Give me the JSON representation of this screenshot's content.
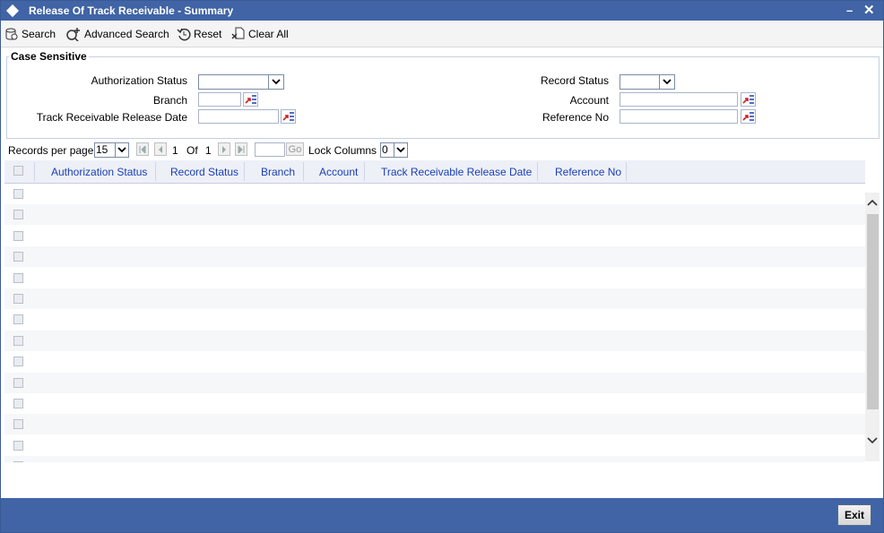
{
  "window": {
    "title": "Release Of Track Receivable - Summary",
    "minimize_label": "–",
    "close_label": "✕"
  },
  "toolbar": {
    "search": "Search",
    "advanced_search": "Advanced Search",
    "reset": "Reset",
    "clear_all": "Clear All"
  },
  "criteria": {
    "legend": "Case Sensitive",
    "authorization_status": {
      "label": "Authorization Status",
      "value": ""
    },
    "branch": {
      "label": "Branch",
      "value": ""
    },
    "track_receivable_release_date": {
      "label": "Track Receivable Release Date",
      "value": ""
    },
    "record_status": {
      "label": "Record Status",
      "value": ""
    },
    "account": {
      "label": "Account",
      "value": ""
    },
    "reference_no": {
      "label": "Reference No",
      "value": ""
    }
  },
  "pager": {
    "records_per_page_label": "Records per page",
    "records_per_page": "15",
    "current_page": "1",
    "of_label": "Of",
    "total_pages": "1",
    "go_label": "Go",
    "lock_columns_label": "Lock Columns",
    "lock_columns": "0"
  },
  "grid": {
    "columns": [
      "Authorization Status",
      "Record Status",
      "Branch",
      "Account",
      "Track Receivable Release Date",
      "Reference No"
    ],
    "row_count": 14
  },
  "footer": {
    "exit": "Exit"
  },
  "colors": {
    "titlebar": "#4064a5",
    "header_text": "#1a3fb5",
    "lov_accent": "#d02020"
  }
}
